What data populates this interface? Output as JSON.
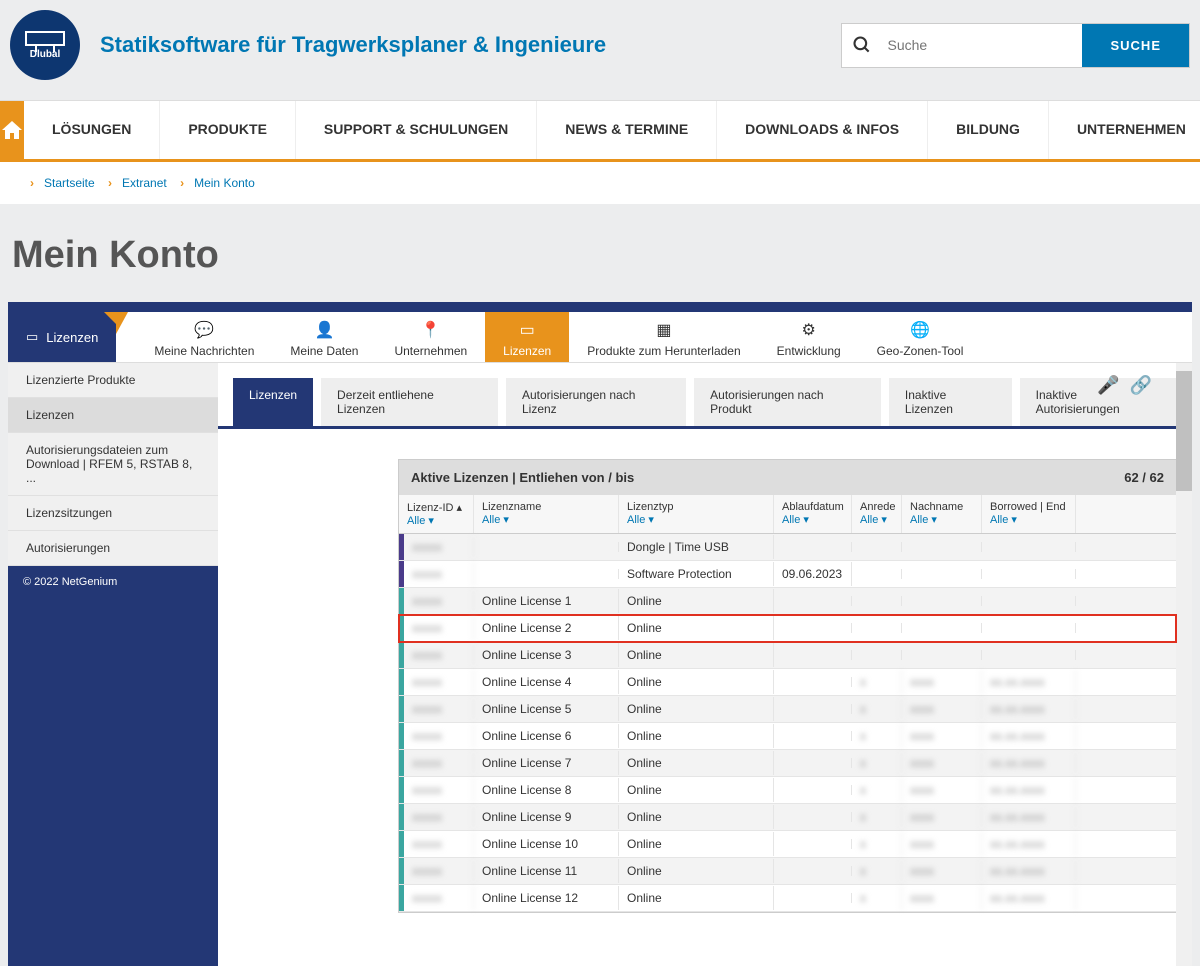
{
  "header": {
    "logo_text": "Dlubal",
    "tagline": "Statiksoftware für Tragwerksplaner & Ingenieure",
    "search_placeholder": "Suche",
    "search_button": "SUCHE"
  },
  "nav": {
    "items": [
      "LÖSUNGEN",
      "PRODUKTE",
      "SUPPORT & SCHULUNGEN",
      "NEWS & TERMINE",
      "DOWNLOADS & INFOS",
      "BILDUNG",
      "UNTERNEHMEN"
    ]
  },
  "breadcrumb": {
    "items": [
      "Startseite",
      "Extranet",
      "Mein Konto"
    ]
  },
  "page_title": "Mein Konto",
  "tabbar": {
    "active": "Lizenzen",
    "items": [
      {
        "label": "Meine Nachrichten",
        "icon": "☰"
      },
      {
        "label": "Meine Daten",
        "icon": "👤"
      },
      {
        "label": "Unternehmen",
        "icon": "📍"
      },
      {
        "label": "Lizenzen",
        "icon": "▭"
      },
      {
        "label": "Produkte zum Herunterladen",
        "icon": "▦"
      },
      {
        "label": "Entwicklung",
        "icon": "⚙"
      },
      {
        "label": "Geo-Zonen-Tool",
        "icon": "🌐"
      }
    ]
  },
  "sidebar": {
    "items": [
      "Lizenzierte Produkte",
      "Lizenzen",
      "Autorisierungsdateien zum Download | RFEM 5, RSTAB 8, ...",
      "Lizenzsitzungen",
      "Autorisierungen"
    ],
    "footer": "© 2022 NetGenium"
  },
  "subtabs": [
    "Lizenzen",
    "Derzeit entliehene Lizenzen",
    "Autorisierungen nach Lizenz",
    "Autorisierungen nach Produkt",
    "Inaktive Lizenzen",
    "Inaktive Autorisierungen"
  ],
  "grid": {
    "title": "Aktive Lizenzen | Entliehen von / bis",
    "count": "62 / 62",
    "columns": [
      {
        "label": "Lizenz-ID",
        "filter": "Alle"
      },
      {
        "label": "Lizenzname",
        "filter": "Alle"
      },
      {
        "label": "Lizenztyp",
        "filter": "Alle"
      },
      {
        "label": "Ablaufdatum",
        "filter": "Alle"
      },
      {
        "label": "Anrede",
        "filter": "Alle"
      },
      {
        "label": "Nachname",
        "filter": "Alle"
      },
      {
        "label": "Borrowed | End",
        "filter": "Alle"
      }
    ],
    "rows": [
      {
        "color": "#4a3b8a",
        "id": "",
        "name": "",
        "type": "Dongle | Time USB",
        "exp": "",
        "an": "",
        "nn": "",
        "be": "",
        "blur": true
      },
      {
        "color": "#4a3b8a",
        "id": "",
        "name": "",
        "type": "Software Protection",
        "exp": "09.06.2023",
        "an": "",
        "nn": "",
        "be": "",
        "blur": true
      },
      {
        "color": "#3aa6a0",
        "id": "",
        "name": "Online License 1",
        "type": "Online",
        "exp": "",
        "an": "",
        "nn": "",
        "be": "",
        "blur": true
      },
      {
        "color": "#3aa6a0",
        "id": "",
        "name": "Online License 2",
        "type": "Online",
        "exp": "",
        "an": "",
        "nn": "",
        "be": "",
        "blur": true,
        "highlight": true
      },
      {
        "color": "#3aa6a0",
        "id": "",
        "name": "Online License 3",
        "type": "Online",
        "exp": "",
        "an": "",
        "nn": "",
        "be": "",
        "blur": true
      },
      {
        "color": "#3aa6a0",
        "id": "",
        "name": "Online License 4",
        "type": "Online",
        "exp": "",
        "an": "x",
        "nn": "xxxx",
        "be": "xx.xx.xxxx",
        "blur": true
      },
      {
        "color": "#3aa6a0",
        "id": "",
        "name": "Online License 5",
        "type": "Online",
        "exp": "",
        "an": "x",
        "nn": "xxxx",
        "be": "xx.xx.xxxx",
        "blur": true
      },
      {
        "color": "#3aa6a0",
        "id": "",
        "name": "Online License 6",
        "type": "Online",
        "exp": "",
        "an": "x",
        "nn": "xxxx",
        "be": "xx.xx.xxxx",
        "blur": true
      },
      {
        "color": "#3aa6a0",
        "id": "",
        "name": "Online License 7",
        "type": "Online",
        "exp": "",
        "an": "x",
        "nn": "xxxx",
        "be": "xx.xx.xxxx",
        "blur": true
      },
      {
        "color": "#3aa6a0",
        "id": "",
        "name": "Online License 8",
        "type": "Online",
        "exp": "",
        "an": "x",
        "nn": "xxxx",
        "be": "xx.xx.xxxx",
        "blur": true
      },
      {
        "color": "#3aa6a0",
        "id": "",
        "name": "Online License 9",
        "type": "Online",
        "exp": "",
        "an": "x",
        "nn": "xxxx",
        "be": "xx.xx.xxxx",
        "blur": true
      },
      {
        "color": "#3aa6a0",
        "id": "",
        "name": "Online License 10",
        "type": "Online",
        "exp": "",
        "an": "x",
        "nn": "xxxx",
        "be": "xx.xx.xxxx",
        "blur": true
      },
      {
        "color": "#3aa6a0",
        "id": "",
        "name": "Online License 11",
        "type": "Online",
        "exp": "",
        "an": "x",
        "nn": "xxxx",
        "be": "xx.xx.xxxx",
        "blur": true
      },
      {
        "color": "#3aa6a0",
        "id": "",
        "name": "Online License 12",
        "type": "Online",
        "exp": "",
        "an": "x",
        "nn": "xxxx",
        "be": "xx.xx.xxxx",
        "blur": true
      }
    ]
  }
}
